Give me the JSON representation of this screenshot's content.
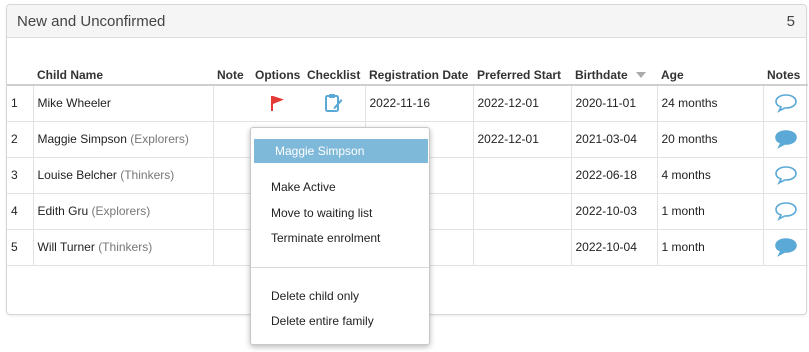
{
  "panel": {
    "title": "New and Unconfirmed",
    "count": "5"
  },
  "columns": {
    "child_name": "Child Name",
    "note": "Note",
    "options": "Options",
    "checklist": "Checklist",
    "registration_date": "Registration Date",
    "preferred_start": "Preferred Start",
    "birthdate": "Birthdate",
    "age": "Age",
    "notes": "Notes"
  },
  "sort_indicator": {
    "column": "Birthdate",
    "direction": "descending"
  },
  "rows": [
    {
      "num": "1",
      "name": "Mike Wheeler",
      "group": "",
      "registration_date": "2022-11-16",
      "preferred_start": "2022-12-01",
      "birthdate": "2020-11-01",
      "age": "24 months",
      "has_flag": true,
      "has_checklist": true,
      "note_filled": false
    },
    {
      "num": "2",
      "name": "Maggie Simpson",
      "group": "(Explorers)",
      "registration_date": "",
      "preferred_start": "2022-12-01",
      "birthdate": "2021-03-04",
      "age": "20 months",
      "has_flag": false,
      "has_checklist": false,
      "note_filled": true
    },
    {
      "num": "3",
      "name": "Louise Belcher",
      "group": "(Thinkers)",
      "registration_date": "",
      "preferred_start": "",
      "birthdate": "2022-06-18",
      "age": "4 months",
      "has_flag": false,
      "has_checklist": false,
      "note_filled": false
    },
    {
      "num": "4",
      "name": "Edith Gru",
      "group": "(Explorers)",
      "registration_date": "",
      "preferred_start": "",
      "birthdate": "2022-10-03",
      "age": "1 month",
      "has_flag": false,
      "has_checklist": false,
      "note_filled": false
    },
    {
      "num": "5",
      "name": "Will Turner",
      "group": "(Thinkers)",
      "registration_date": "",
      "preferred_start": "",
      "birthdate": "2022-10-04",
      "age": "1 month",
      "has_flag": false,
      "has_checklist": false,
      "note_filled": true
    }
  ],
  "context_menu": {
    "header": "Maggie Simpson",
    "make_active": "Make Active",
    "move_to_waiting_list": "Move to waiting list",
    "terminate_enrolment": "Terminate enrolment",
    "delete_child_only": "Delete child only",
    "delete_entire_family": "Delete entire family"
  },
  "colors": {
    "flag": "#e53935",
    "checklist": "#5aa9d6",
    "note_icon": "#5aa9d6",
    "menu_header_bg": "#7fb9d9",
    "highlight_ring": "#e01f1f"
  },
  "icons": {
    "flag": "flag-icon",
    "checklist": "checklist-edit-icon",
    "note": "speech-bubble-icon"
  }
}
